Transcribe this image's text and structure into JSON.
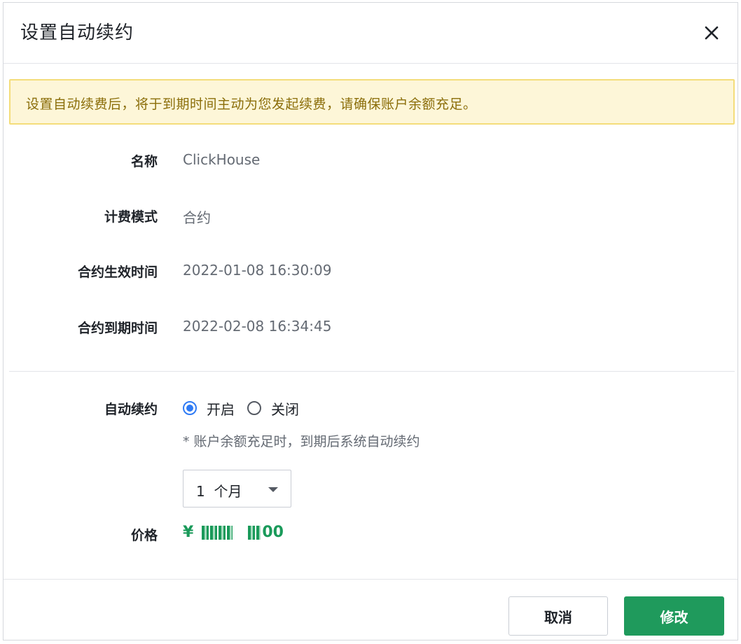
{
  "dialog": {
    "title": "设置自动续约",
    "close_icon": "close-icon"
  },
  "notice": {
    "text": "设置自动续费后，将于到期时间主动为您发起续费，请确保账户余额充足。",
    "color": "#8b6e0a",
    "background": "#fdf6d8"
  },
  "info": {
    "name_label": "名称",
    "name_value": "ClickHouse",
    "billing_label": "计费模式",
    "billing_value": "合约",
    "start_label": "合约生效时间",
    "start_value": "2022-01-08 16:30:09",
    "end_label": "合约到期时间",
    "end_value": "2022-02-08 16:34:45"
  },
  "renew": {
    "label": "自动续约",
    "options": [
      {
        "label": "开启",
        "checked": true
      },
      {
        "label": "关闭",
        "checked": false
      }
    ],
    "hint": "* 账户余额充足时，到期后系统自动续约",
    "period_value": "1  个月"
  },
  "price": {
    "label": "价格",
    "currency": "¥",
    "suffix": "00",
    "color": "#1a9a5a"
  },
  "footer": {
    "cancel_label": "取消",
    "ok_label": "修改",
    "ok_color": "#1f9a5c"
  }
}
